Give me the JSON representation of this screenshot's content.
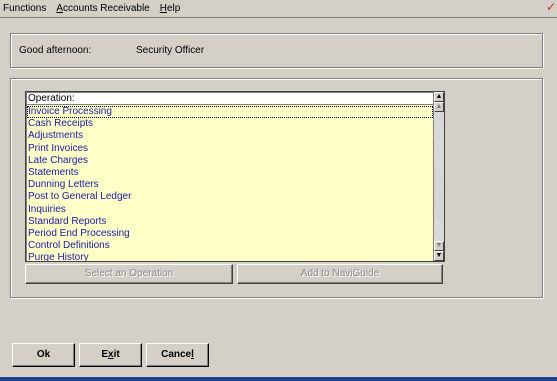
{
  "menu": {
    "items": [
      {
        "label": "Functions"
      },
      {
        "pre": "",
        "ul": "A",
        "post": "ccounts Receivable"
      },
      {
        "pre": "",
        "ul": "H",
        "post": "elp"
      }
    ]
  },
  "greeting": {
    "label": "Good afternoon:",
    "user": "Security Officer"
  },
  "operations": {
    "header": "Operation:",
    "items": [
      "Invoice Processing",
      "Cash Receipts",
      "Adjustments",
      "Print Invoices",
      "Late Charges",
      "Statements",
      "Dunning Letters",
      "Post to General Ledger",
      "Inquiries",
      "Standard Reports",
      "Period End Processing",
      "Control Definitions",
      "Purge History"
    ],
    "selected_index": 0
  },
  "buttons": {
    "select_operation": "Select an Operation",
    "add_naviguide": "Add to NaviGuide",
    "ok": "Ok",
    "exit_pre": "E",
    "exit_ul": "x",
    "exit_post": "it",
    "cancel_pre": "Cance",
    "cancel_ul": "l",
    "cancel_post": ""
  },
  "colors": {
    "list_background": "#ffffc8",
    "list_text": "#1a1aa8",
    "window_background": "#d4d0c8"
  }
}
